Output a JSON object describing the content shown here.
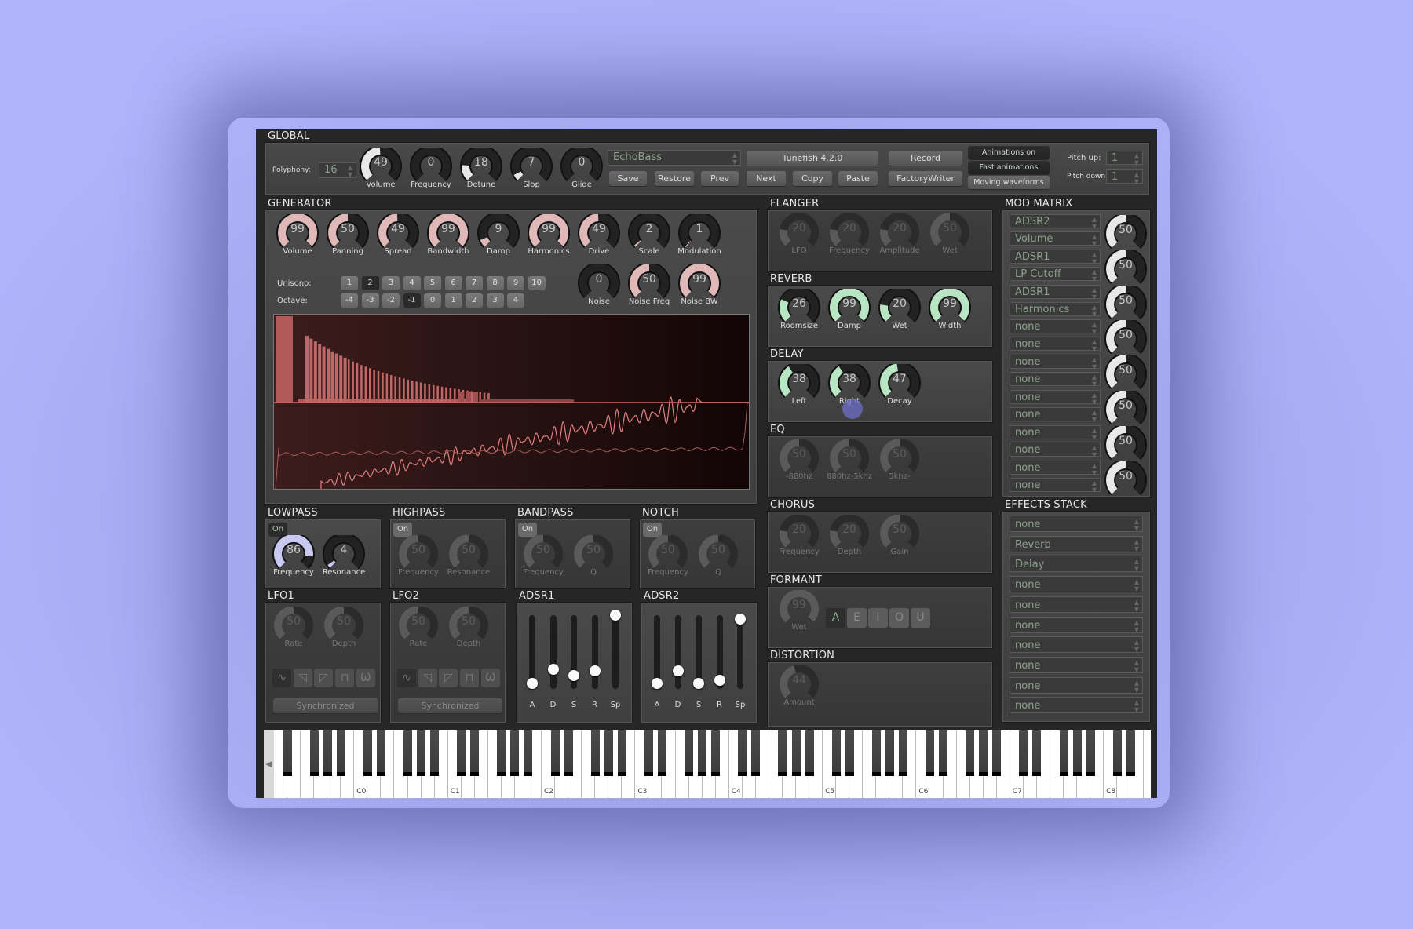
{
  "colors": {
    "generator": "#e0b8b8",
    "reverb": "#b8e6c4",
    "delay": "#b8e6c4",
    "lowpass": "#c8c8f0",
    "modmatrix": "#e8e8e8",
    "global": "#e8e8e8"
  },
  "global": {
    "title": "GLOBAL",
    "polyphony_label": "Polyphony:",
    "polyphony_value": "16",
    "knobs": [
      {
        "label": "Volume",
        "value": 49
      },
      {
        "label": "Frequency",
        "value": 0
      },
      {
        "label": "Detune",
        "value": 18
      },
      {
        "label": "Slop",
        "value": 7
      },
      {
        "label": "Glide",
        "value": 0
      }
    ],
    "preset": "EchoBass",
    "version_button": "Tunefish 4.2.0",
    "buttons": {
      "save": "Save",
      "restore": "Restore",
      "prev": "Prev",
      "next": "Next",
      "copy": "Copy",
      "paste": "Paste",
      "record": "Record",
      "factorywriter": "FactoryWriter"
    },
    "toggles": [
      {
        "label": "Animations on",
        "active": true
      },
      {
        "label": "Fast animations",
        "active": true
      },
      {
        "label": "Moving waveforms",
        "active": false
      }
    ],
    "pitch_up_label": "Pitch up:",
    "pitch_up": "1",
    "pitch_down_label": "Pitch down:",
    "pitch_down": "1"
  },
  "generator": {
    "title": "GENERATOR",
    "knobs": [
      {
        "label": "Volume",
        "value": 99
      },
      {
        "label": "Panning",
        "value": 50
      },
      {
        "label": "Spread",
        "value": 49
      },
      {
        "label": "Bandwidth",
        "value": 99
      },
      {
        "label": "Damp",
        "value": 9
      },
      {
        "label": "Harmonics",
        "value": 99
      },
      {
        "label": "Drive",
        "value": 49
      },
      {
        "label": "Scale",
        "value": 2
      },
      {
        "label": "Modulation",
        "value": 1
      }
    ],
    "noise_knobs": [
      {
        "label": "Noise",
        "value": 0
      },
      {
        "label": "Noise Freq",
        "value": 50
      },
      {
        "label": "Noise BW",
        "value": 99
      }
    ],
    "unisono_label": "Unisono:",
    "unisono": [
      "1",
      "2",
      "3",
      "4",
      "5",
      "6",
      "7",
      "8",
      "9",
      "10"
    ],
    "unisono_selected": "2",
    "octave_label": "Octave:",
    "octave": [
      "-4",
      "-3",
      "-2",
      "-1",
      "0",
      "1",
      "2",
      "3",
      "4"
    ],
    "octave_selected": "-1"
  },
  "filters": [
    {
      "title": "LOWPASS",
      "on_label": "On",
      "on": true,
      "knobs": [
        {
          "label": "Frequency",
          "value": 86
        },
        {
          "label": "Resonance",
          "value": 4
        }
      ]
    },
    {
      "title": "HIGHPASS",
      "on_label": "On",
      "on": false,
      "knobs": [
        {
          "label": "Frequency",
          "value": 50
        },
        {
          "label": "Resonance",
          "value": 50
        }
      ]
    },
    {
      "title": "BANDPASS",
      "on_label": "On",
      "on": false,
      "knobs": [
        {
          "label": "Frequency",
          "value": 50
        },
        {
          "label": "Q",
          "value": 50
        }
      ]
    },
    {
      "title": "NOTCH",
      "on_label": "On",
      "on": false,
      "knobs": [
        {
          "label": "Frequency",
          "value": 50
        },
        {
          "label": "Q",
          "value": 50
        }
      ]
    }
  ],
  "lfos": [
    {
      "title": "LFO1",
      "knobs": [
        {
          "label": "Rate",
          "value": 50
        },
        {
          "label": "Depth",
          "value": 50
        }
      ],
      "shapes": [
        "sine",
        "saw-down",
        "saw-up",
        "square",
        "noise"
      ],
      "shape_selected": "sine",
      "sync_label": "Synchronized"
    },
    {
      "title": "LFO2",
      "knobs": [
        {
          "label": "Rate",
          "value": 50
        },
        {
          "label": "Depth",
          "value": 50
        }
      ],
      "shapes": [
        "sine",
        "saw-down",
        "saw-up",
        "square",
        "noise"
      ],
      "shape_selected": "sine",
      "sync_label": "Synchronized"
    }
  ],
  "adsrs": [
    {
      "title": "ADSR1",
      "sliders": [
        {
          "label": "A",
          "value": 0.08
        },
        {
          "label": "D",
          "value": 0.27
        },
        {
          "label": "S",
          "value": 0.18
        },
        {
          "label": "R",
          "value": 0.24
        },
        {
          "label": "Sp",
          "value": 1.0
        }
      ]
    },
    {
      "title": "ADSR2",
      "sliders": [
        {
          "label": "A",
          "value": 0.08
        },
        {
          "label": "D",
          "value": 0.24
        },
        {
          "label": "S",
          "value": 0.07
        },
        {
          "label": "R",
          "value": 0.12
        },
        {
          "label": "Sp",
          "value": 0.95
        }
      ]
    }
  ],
  "effects": [
    {
      "title": "FLANGER",
      "enabled": false,
      "knobs": [
        {
          "label": "LFO",
          "value": 20
        },
        {
          "label": "Frequency",
          "value": 20
        },
        {
          "label": "Amplitude",
          "value": 20
        },
        {
          "label": "Wet",
          "value": 50
        }
      ]
    },
    {
      "title": "REVERB",
      "enabled": true,
      "knobs": [
        {
          "label": "Roomsize",
          "value": 26
        },
        {
          "label": "Damp",
          "value": 99
        },
        {
          "label": "Wet",
          "value": 20
        },
        {
          "label": "Width",
          "value": 99
        }
      ]
    },
    {
      "title": "DELAY",
      "enabled": true,
      "knobs": [
        {
          "label": "Left",
          "value": 38
        },
        {
          "label": "Right",
          "value": 38
        },
        {
          "label": "Decay",
          "value": 47
        }
      ]
    },
    {
      "title": "EQ",
      "enabled": false,
      "knobs": [
        {
          "label": "-880hz",
          "value": 50
        },
        {
          "label": "880hz-5khz",
          "value": 50
        },
        {
          "label": "5khz-",
          "value": 50
        }
      ]
    },
    {
      "title": "CHORUS",
      "enabled": false,
      "knobs": [
        {
          "label": "Frequency",
          "value": 20
        },
        {
          "label": "Depth",
          "value": 20
        },
        {
          "label": "Gain",
          "value": 50
        }
      ]
    },
    {
      "title": "FORMANT",
      "enabled": false,
      "knobs": [
        {
          "label": "Wet",
          "value": 99
        }
      ],
      "vowels": [
        "A",
        "E",
        "I",
        "O",
        "U"
      ],
      "vowel_selected": "A"
    },
    {
      "title": "DISTORTION",
      "enabled": false,
      "knobs": [
        {
          "label": "Amount",
          "value": 44
        }
      ]
    }
  ],
  "mod_matrix": {
    "title": "MOD MATRIX",
    "slots": [
      {
        "source": "ADSR2",
        "target": "Volume",
        "amount": 50
      },
      {
        "source": "ADSR1",
        "target": "LP Cutoff",
        "amount": 50
      },
      {
        "source": "ADSR1",
        "target": "Harmonics",
        "amount": 50
      },
      {
        "source": "none",
        "target": "none",
        "amount": 50
      },
      {
        "source": "none",
        "target": "none",
        "amount": 50
      },
      {
        "source": "none",
        "target": "none",
        "amount": 50
      },
      {
        "source": "none",
        "target": "none",
        "amount": 50
      },
      {
        "source": "none",
        "target": "none",
        "amount": 50
      }
    ]
  },
  "effects_stack": {
    "title": "EFFECTS STACK",
    "items": [
      "none",
      "Reverb",
      "Delay",
      "none",
      "none",
      "none",
      "none",
      "none",
      "none",
      "none"
    ]
  },
  "keyboard": {
    "octave_labels": [
      "C0",
      "C1",
      "C2",
      "C3",
      "C4",
      "C5",
      "C6",
      "C7",
      "C8"
    ],
    "scroll_left": "◀"
  }
}
